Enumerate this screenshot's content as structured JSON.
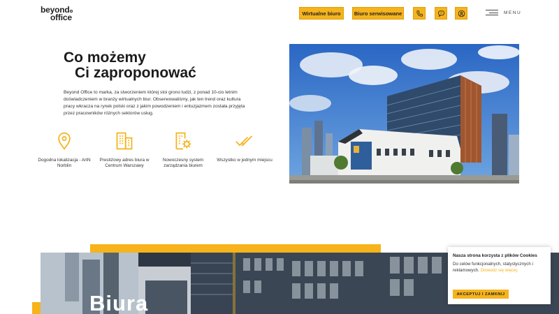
{
  "header": {
    "logo_line1": "beyond",
    "logo_line2": "office",
    "btn_virtual": "Wirtualne biuro",
    "btn_serviced": "Biuro serwisowane",
    "icons": [
      "phone-icon",
      "chat-icon",
      "user-icon"
    ],
    "menu_label": "MENU"
  },
  "main": {
    "heading_line1": "Co możemy",
    "heading_line2": "Ci zaproponować",
    "intro": "Beyond Office to marka, za stworzeniem której stoi grono ludzi, z ponad 10-cio letnim doświadczeniem w branży wirtualnych biur. Obserwowaliśmy, jak ten trend oraz kultura pracy wkracza na rynek polski oraz z jakim powodzeniem i entuzjazmem została przyjęta przez pracowników różnych sektorów usług.",
    "features": [
      {
        "icon": "location-pin-icon",
        "label": "Dogodna lokalizacja - ArtN Norblin"
      },
      {
        "icon": "office-building-icon",
        "label": "Prestiżowy adres biura w Centrum Warszawy"
      },
      {
        "icon": "building-settings-icon",
        "label": "Nowoczesny system zarządzania biurem"
      },
      {
        "icon": "double-check-icon",
        "label": "Wszystko w jednym miejscu"
      }
    ]
  },
  "bottom": {
    "title": "Biura"
  },
  "cookie": {
    "title": "Nasza strona korzysta z plików Cookies",
    "text": "Do celów funkcjonalnych, statystycznych i reklamowych.",
    "more": "Dowiedz się więcej.",
    "accept": "AKCEPTUJ I ZAMKNIJ"
  },
  "colors": {
    "accent": "#f6b31c",
    "text": "#1b1b1b",
    "background": "#ffffff"
  }
}
